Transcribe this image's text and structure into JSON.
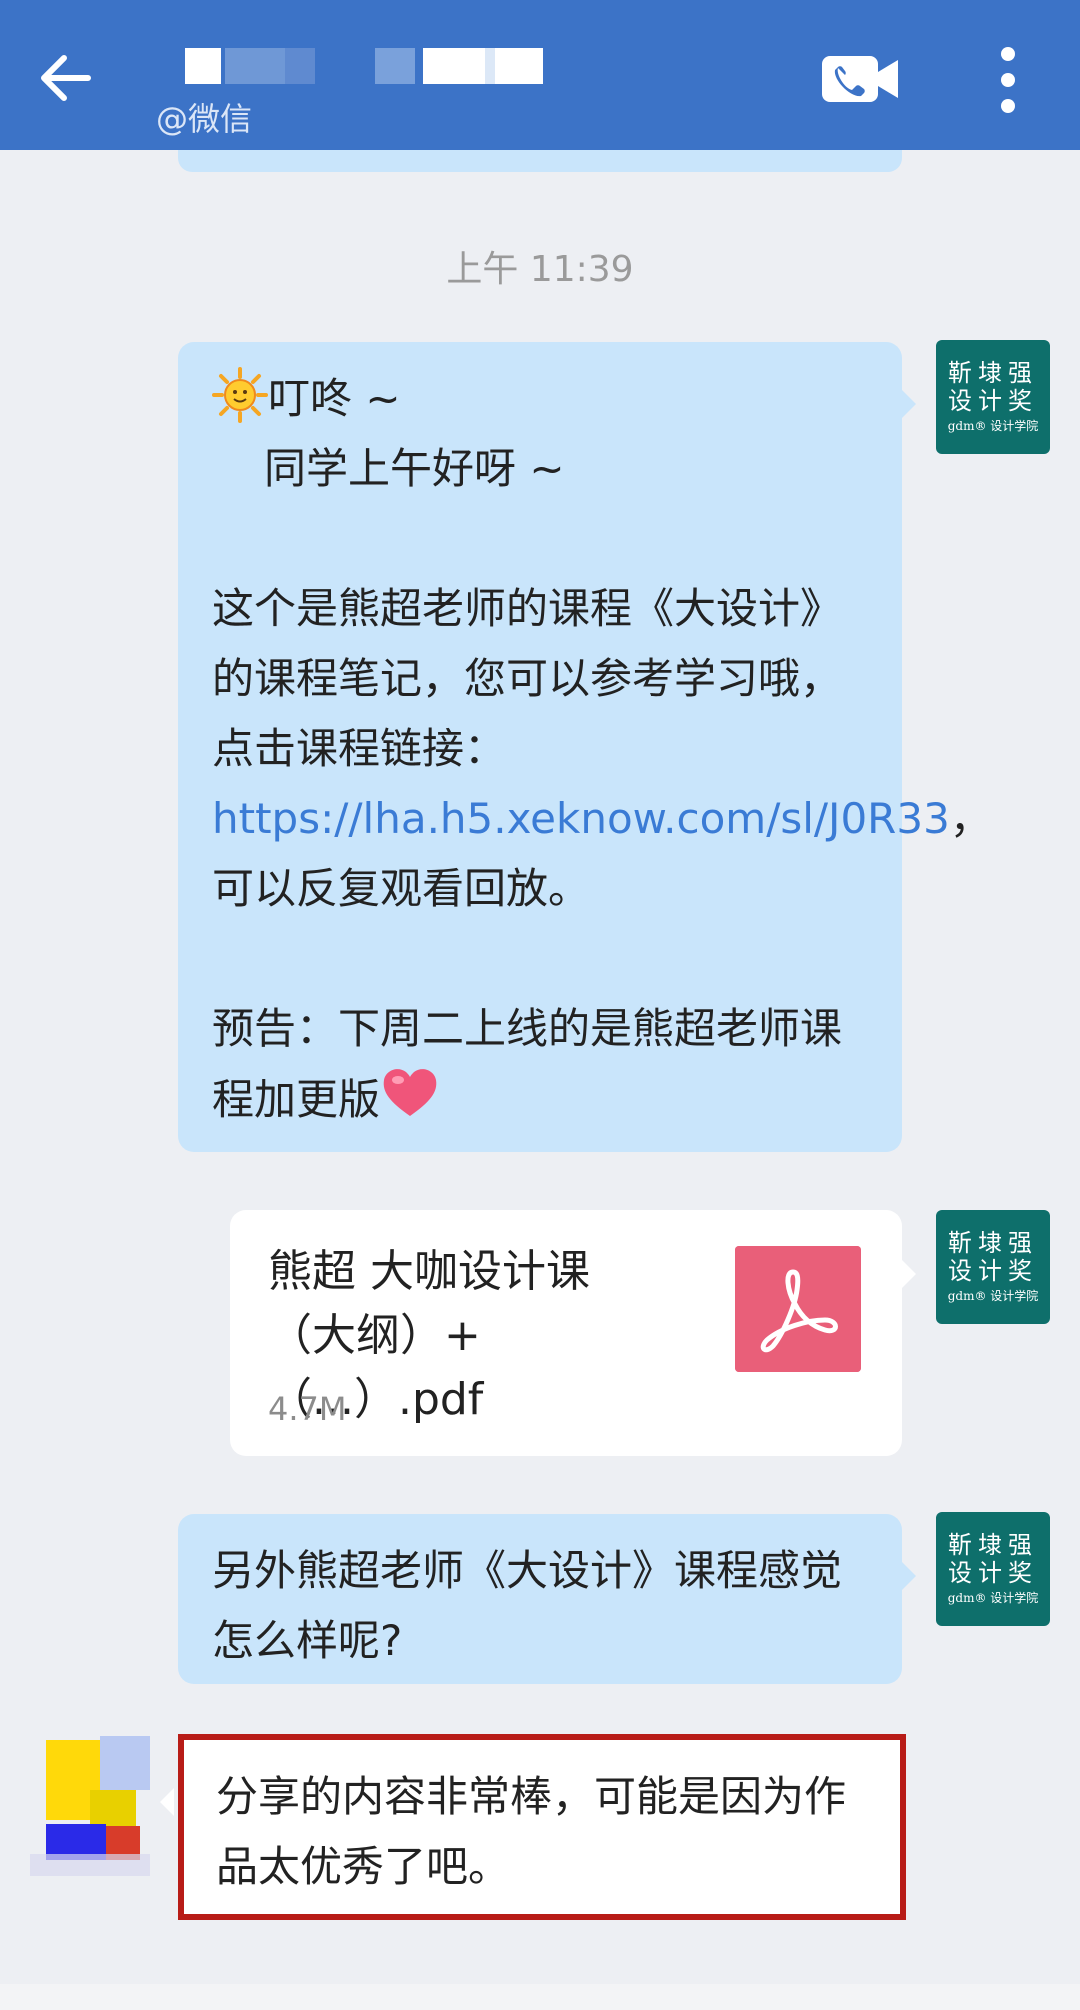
{
  "header": {
    "subtitle": "@微信"
  },
  "chat": {
    "timestamp": "上午 11:39",
    "bot_avatar": {
      "row1": "靳埭强",
      "row2": "设计奖",
      "row3": "gdm® 设计学院"
    },
    "message1": {
      "line1": "叮咚 ~",
      "line2": "同学上午好呀 ~",
      "para2_prefix": "这个是熊超老师的课程《大设计》的课程笔记，您可以参考学习哦，点击课程链接：",
      "link": "https://lha.h5.xeknow.com/sl/J0R33",
      "para2_suffix": "，可以反复观看回放。",
      "para3": "预告：下周二上线的是熊超老师课程加更版"
    },
    "file": {
      "name": "熊超 大咖设计课（大纲）+（...）.pdf",
      "size": "4.7M",
      "icon": "pdf-icon"
    },
    "message3": "另外熊超老师《大设计》课程感觉怎么样呢?",
    "reply": "分享的内容非常棒，可能是因为作品太优秀了吧。"
  },
  "colors": {
    "header": "#3c73c7",
    "bubble_blue": "#c9e5fb",
    "link": "#3a7bd5",
    "highlight_border": "#b81c17",
    "pdf_icon": "#e95f79",
    "bot_avatar": "#0e6f6b"
  }
}
